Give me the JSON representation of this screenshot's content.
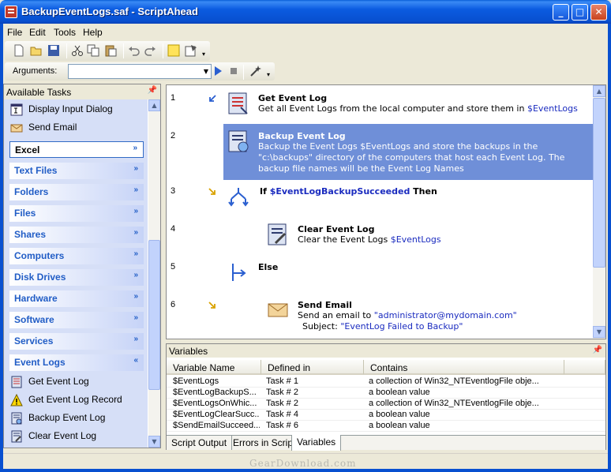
{
  "window": {
    "title": "BackupEventLogs.saf - ScriptAhead"
  },
  "menu": {
    "items": [
      "File",
      "Edit",
      "Tools",
      "Help"
    ]
  },
  "toolbar": {
    "icons": [
      "new-file-icon",
      "open-folder-icon",
      "save-icon",
      "cut-icon",
      "copy-icon",
      "paste-icon",
      "undo-icon",
      "redo-icon",
      "note-icon",
      "properties-icon"
    ]
  },
  "arguments": {
    "label": "Arguments:",
    "value": ""
  },
  "left_panel": {
    "title": "Available Tasks",
    "top_items": [
      {
        "label": "Display Input Dialog",
        "icon": "dialog-icon"
      },
      {
        "label": "Send Email",
        "icon": "envelope-icon"
      }
    ],
    "categories": [
      {
        "label": "Excel",
        "selected": true
      },
      {
        "label": "Text Files"
      },
      {
        "label": "Folders"
      },
      {
        "label": "Files"
      },
      {
        "label": "Shares"
      },
      {
        "label": "Computers"
      },
      {
        "label": "Disk Drives"
      },
      {
        "label": "Hardware"
      },
      {
        "label": "Software"
      },
      {
        "label": "Services"
      },
      {
        "label": "Event Logs",
        "expanded": true
      }
    ],
    "event_log_items": [
      {
        "label": "Get Event Log",
        "icon": "eventlog-icon"
      },
      {
        "label": "Get Event Log Record",
        "icon": "warning-icon"
      },
      {
        "label": "Backup Event Log",
        "icon": "backup-icon"
      },
      {
        "label": "Clear Event Log",
        "icon": "clear-icon"
      }
    ]
  },
  "script": {
    "line_numbers": [
      "1",
      "2",
      "3",
      "4",
      "5",
      "6"
    ],
    "s1_title": "Get Event Log",
    "s1_desc": "Get all Event Logs from  the local computer and store them in ",
    "s1_var": "$EventLogs",
    "s2_title": "Backup Event Log",
    "s2_l1": "Backup the Event Logs $EventLogs and store the backups in the",
    "s2_l2": "\"c:\\backups\" directory of the computers that host each Event Log.  The",
    "s2_l3": "backup file names will be the Event Log Names",
    "s3_if": "If ",
    "s3_var": "$EventLogBackupSucceeded",
    "s3_then": " Then",
    "s4_title": "Clear Event Log",
    "s4_desc": "Clear the Event Logs ",
    "s4_var": "$EventLogs",
    "s5_else": "Else",
    "s6_title": "Send Email",
    "s6_desc": "Send an email to ",
    "s6_to": "\"administrator@mydomain.com\"",
    "s6_subj": "Subject: ",
    "s6_subj_val": "\"EventLog Failed to Backup\""
  },
  "variables": {
    "title": "Variables",
    "columns": [
      "Variable Name",
      "Defined in",
      "Contains"
    ],
    "rows": [
      [
        "$EventLogs",
        "Task # 1",
        "a collection of Win32_NTEventlogFile obje..."
      ],
      [
        "$EventLogBackupS...",
        "Task # 2",
        "a boolean value"
      ],
      [
        "$EventLogsOnWhic...",
        "Task # 2",
        "a collection of Win32_NTEventlogFile obje..."
      ],
      [
        "$EventLogClearSucc...",
        "Task # 4",
        "a boolean value"
      ],
      [
        "$SendEmailSucceed...",
        "Task # 6",
        "a boolean value"
      ]
    ],
    "tabs": [
      "Script Output",
      "Errors in Script",
      "Variables"
    ]
  },
  "watermark": "GearDownload.com"
}
